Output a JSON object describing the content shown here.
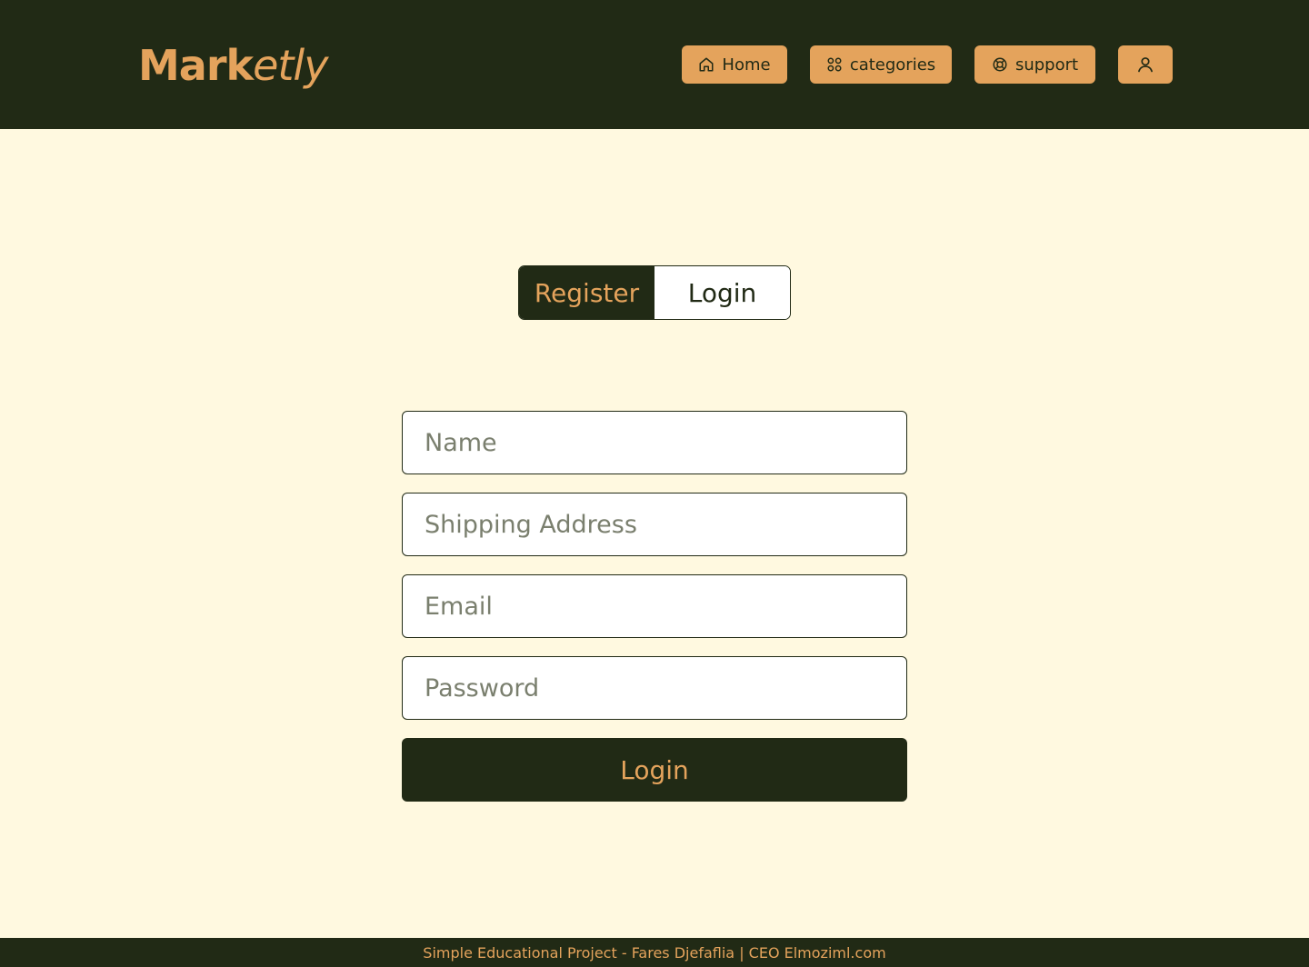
{
  "brand": {
    "name_bold": "Mark",
    "name_italic": "etly"
  },
  "nav": {
    "home_label": "Home",
    "categories_label": "categories",
    "support_label": "support"
  },
  "auth_toggle": {
    "register_label": "Register",
    "login_label": "Login",
    "active": "register"
  },
  "form": {
    "name_placeholder": "Name",
    "address_placeholder": "Shipping Address",
    "email_placeholder": "Email",
    "password_placeholder": "Password",
    "submit_label": "Login"
  },
  "footer": {
    "text": "Simple Educational Project - Fares Djefaflia | CEO Elmoziml.com"
  },
  "colors": {
    "dark": "#212a15",
    "accent": "#e4a35c",
    "background": "#fff9e0"
  },
  "icons": {
    "home": "home-icon",
    "categories": "grid-icon",
    "support": "lifebuoy-icon",
    "account": "user-icon"
  }
}
